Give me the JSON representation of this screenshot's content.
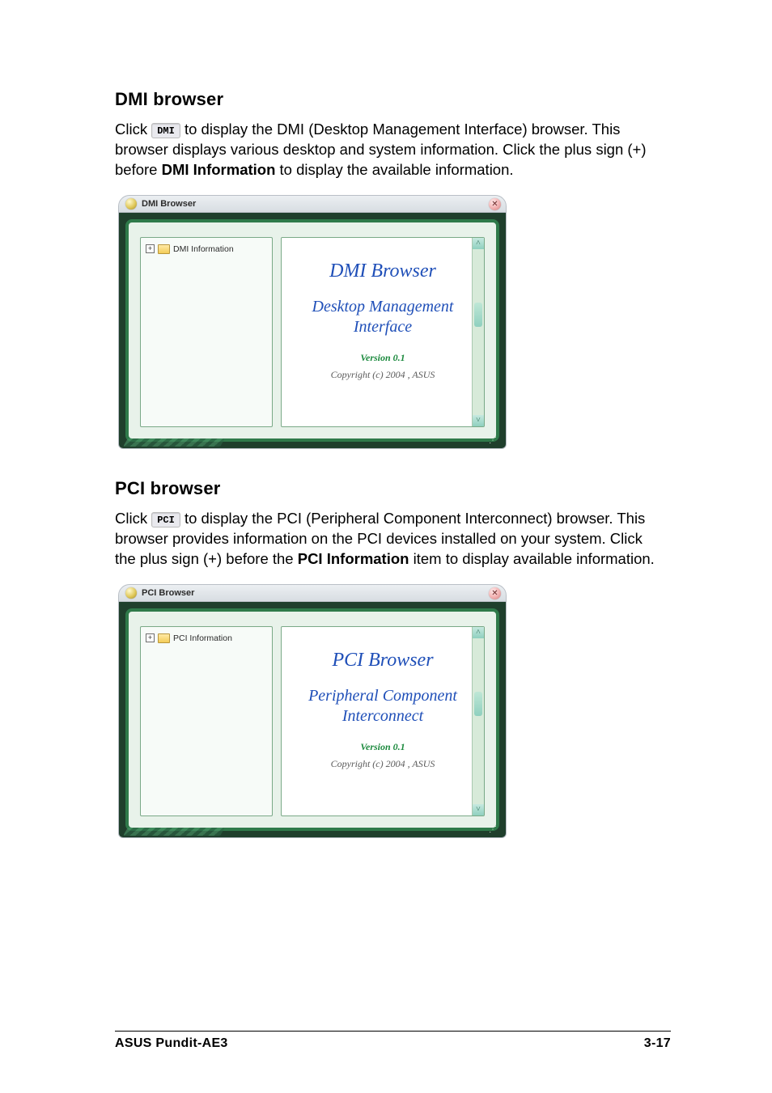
{
  "sections": {
    "dmi": {
      "heading": "DMI browser",
      "btn_label": "DMI",
      "para_pre": "Click ",
      "para_mid1": " to display the DMI (Desktop Management Interface) browser. This browser displays various desktop and system information. Click the plus sign (+) before ",
      "bold_term": "DMI Information",
      "para_mid2": " to display the available information."
    },
    "pci": {
      "heading": "PCI browser",
      "btn_label": "PCI",
      "para_pre": "Click ",
      "para_mid1": " to display the PCI (Peripheral Component Interconnect) browser. This browser provides information on the PCI devices installed on your system. Click the plus sign (+) before the ",
      "bold_term": "PCI Information",
      "para_mid2": " item to display available information."
    }
  },
  "windows": {
    "dmi": {
      "title": "DMI Browser",
      "tree_root": "DMI Information",
      "headline": "DMI  Browser",
      "sub1": "Desktop Management",
      "sub2": "Interface",
      "version": "Version  0.1",
      "copyright": "Copyright (c) 2004 ,   ASUS"
    },
    "pci": {
      "title": "PCI Browser",
      "tree_root": "PCI Information",
      "headline": "PCI  Browser",
      "sub1": "Peripheral Component",
      "sub2": "Interconnect",
      "version": "Version  0.1",
      "copyright": "Copyright (c) 2004 ,   ASUS"
    }
  },
  "scroll": {
    "up": "˄",
    "down": "˅"
  },
  "footer": {
    "left": "ASUS Pundit-AE3",
    "right": "3-17"
  }
}
